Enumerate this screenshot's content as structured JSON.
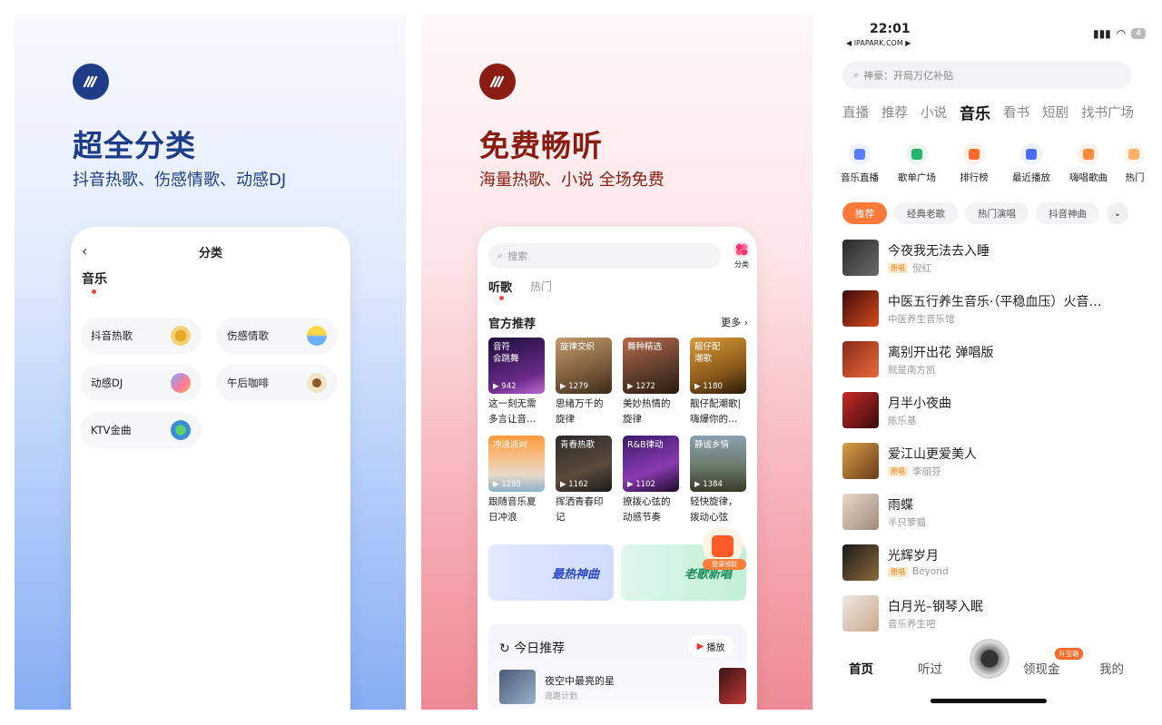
{
  "panel1": {
    "headline": "超全分类",
    "sub": "抖音热歌、伤感情歌、动感DJ",
    "accent": "#1f3c88",
    "nav_title": "分类",
    "section": "音乐",
    "categories": [
      "抖音热歌",
      "伤感情歌",
      "动感DJ",
      "午后咖啡",
      "KTV金曲"
    ]
  },
  "panel2": {
    "headline": "免费畅听",
    "sub": "海量热歌、小说 全场免费",
    "accent": "#8a1c14",
    "search_placeholder": "搜索",
    "category_label": "分类",
    "tabs": [
      "听歌",
      "热门"
    ],
    "section_title": "官方推荐",
    "more": "更多",
    "cards": [
      {
        "cover": "音符\n会跳舞",
        "count": "942",
        "caption": "这一刻无需多言让音…"
      },
      {
        "cover": "旋律交织",
        "count": "1279",
        "caption": "思绪万千的旋律"
      },
      {
        "cover": "舞种精选",
        "count": "1272",
        "caption": "美妙热情的旋律"
      },
      {
        "cover": "靓仔配\n潮歌",
        "count": "1180",
        "caption": "靓仔配潮歌|嗨爆你的…"
      },
      {
        "cover": "冲浪派对",
        "count": "1295",
        "caption": "跟随音乐夏日冲浪"
      },
      {
        "cover": "青春热歌",
        "count": "1162",
        "caption": "挥洒青春印记"
      },
      {
        "cover": "R&B律动",
        "count": "1102",
        "caption": "撩拨心弦的动感节奏"
      },
      {
        "cover": "静谧乡情",
        "count": "1384",
        "caption": "轻快旋律，拨动心弦"
      }
    ],
    "banners": [
      "最热神曲",
      "老歌新唱"
    ],
    "float_tag": "登录领取",
    "today_title": "今日推荐",
    "play_label": "播放",
    "today_song": "夜空中最亮的星",
    "today_artist": "逃跑计划"
  },
  "panel3": {
    "time": "22:01",
    "site": "◀ IPAPARK.COM ▶",
    "battery": "4",
    "search_placeholder": "神豪：开局万亿补贴",
    "tabs": [
      "直播",
      "推荐",
      "小说",
      "音乐",
      "看书",
      "短剧",
      "找书广场"
    ],
    "active_tab": 3,
    "icons": [
      {
        "label": "音乐直播",
        "color": "#5b7bff"
      },
      {
        "label": "歌单广场",
        "color": "#28b36b"
      },
      {
        "label": "排行榜",
        "color": "#ff6a2a"
      },
      {
        "label": "最近播放",
        "color": "#4a6cff"
      },
      {
        "label": "嗨唱歌曲",
        "color": "#ff8a3a"
      },
      {
        "label": "热门",
        "color": "#ffb06a"
      }
    ],
    "chips": [
      "推荐",
      "经典老歌",
      "热门演唱",
      "抖音神曲"
    ],
    "songs": [
      {
        "title": "今夜我无法去入睡",
        "artist": "倪红",
        "vip": true
      },
      {
        "title": "中医五行养生音乐·（平稳血压）火音…",
        "artist": "中医养生音乐馆",
        "vip": false
      },
      {
        "title": "离别开出花 弹唱版",
        "artist": "就是南方凯",
        "vip": false
      },
      {
        "title": "月半小夜曲",
        "artist": "陈乐基",
        "vip": false
      },
      {
        "title": "爱江山更爱美人",
        "artist": "李丽芬",
        "vip": true
      },
      {
        "title": "雨蝶",
        "artist": "半只箩猫",
        "vip": false
      },
      {
        "title": "光辉岁月",
        "artist": "Beyond",
        "vip": true
      },
      {
        "title": "白月光–钢琴入眠",
        "artist": "音乐养生吧",
        "vip": false
      }
    ],
    "vip_label": "原唱",
    "nav": [
      "首页",
      "听过",
      "领现金",
      "我的"
    ],
    "nav_badge": "升宝箱"
  }
}
